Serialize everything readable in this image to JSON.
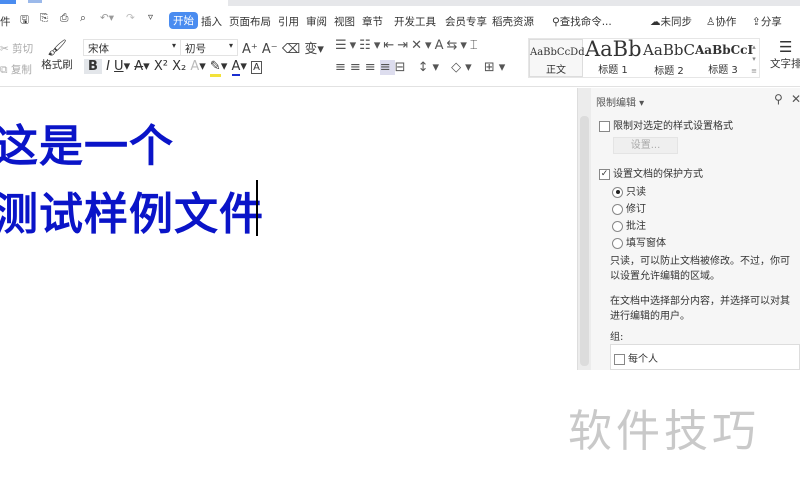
{
  "menu": {
    "items": [
      "开始",
      "插入",
      "页面布局",
      "引用",
      "审阅",
      "视图",
      "章节",
      "开发工具",
      "会员专享",
      "稻壳资源"
    ],
    "search_placeholder": "查找命令...",
    "sync": "未同步",
    "collab": "协作",
    "share": "分享",
    "file_partial": "件"
  },
  "toolbar": {
    "cut": "剪切",
    "copy": "复制",
    "format_painter": "格式刷",
    "font_name": "宋体",
    "font_size": "初号",
    "styles": [
      "AaBbCcDd",
      "AaBb",
      "AaBbC",
      "AaBbCcI"
    ],
    "style_labels": [
      "正文",
      "标题 1",
      "标题 2",
      "标题 3"
    ],
    "text_layout": "文字排"
  },
  "document": {
    "lines": [
      "这是一个",
      "测试样例文件"
    ]
  },
  "panel": {
    "title": "限制编辑",
    "restrict_format_label": "限制对选定的样式设置格式",
    "settings_button": "设置...",
    "protect_label": "设置文档的保护方式",
    "options": [
      "只读",
      "修订",
      "批注",
      "填写窗体"
    ],
    "selected_option": "只读",
    "desc1": "只读，可以防止文档被修改。不过，你可以设置允许编辑的区域。",
    "desc2": "在文档中选择部分内容，并选择可以对其进行编辑的用户。",
    "group_label": "组:",
    "everyone": "每个人"
  },
  "watermark": "软件技巧",
  "colors": {
    "accent": "#4a8cf0",
    "doc_text": "#0a14c8"
  }
}
